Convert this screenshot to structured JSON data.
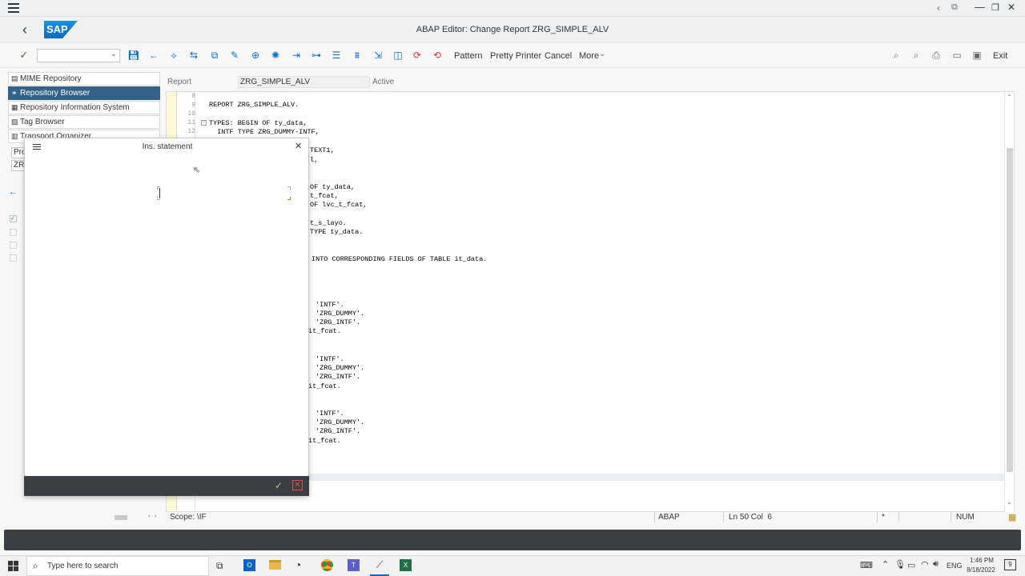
{
  "window": {
    "title": "ABAP Editor: Change Report ZRG_SIMPLE_ALV",
    "logo": "SAP"
  },
  "toolbar": {
    "command_field_value": "",
    "pattern_label": "Pattern",
    "pretty_printer_label": "Pretty Printer",
    "cancel_label": "Cancel",
    "more_label": "More",
    "exit_label": "Exit"
  },
  "nav": {
    "items": [
      {
        "label": "MIME Repository"
      },
      {
        "label": "Repository Browser"
      },
      {
        "label": "Repository Information System"
      },
      {
        "label": "Tag Browser"
      },
      {
        "label": "Transport Organizer"
      }
    ],
    "field1": "Pro",
    "field2": "ZR"
  },
  "editor": {
    "report_label": "Report",
    "report_name": "ZRG_SIMPLE_ALV",
    "status": "Active",
    "line_numbers": [
      "8",
      "9",
      "10",
      "11",
      "12"
    ],
    "lines": [
      "REPORT ZRG_SIMPLE_ALV.",
      "TYPES: BEGIN OF ty_data,",
      "  INTF TYPE ZRG_DUMMY-INTF,",
      "TEXT1,",
      "l,",
      "OF ty_data,",
      "t_fcat,",
      "OF lvc_t_fcat,",
      "t_s_layo.",
      "TYPE ty_data.",
      "INTO CORRESPONDING FIELDS OF TABLE it_data.",
      "'INTF'.",
      "'ZRG_DUMMY'.",
      "'ZRG_INTF'.",
      "it_fcat.",
      "'INTF'.",
      "'ZRG_DUMMY'.",
      "'ZRG_INTF'.",
      "it_fcat.",
      "'INTF'.",
      "'ZRG_DUMMY'.",
      "'ZRG_INTF'.",
      "it_fcat."
    ]
  },
  "status_bar": {
    "scope": "Scope: \\IF",
    "language": "ABAP",
    "position": "Ln 50 Col  6",
    "mode": "*",
    "num": "NUM"
  },
  "dialog": {
    "title": "Ins. statement"
  },
  "taskbar": {
    "search_placeholder": "Type here to search",
    "lang": "ENG",
    "time": "1:46 PM",
    "date": "8/18/2022",
    "notifications": "9"
  },
  "colors": {
    "selected_nav": "#346187",
    "accent": "#0a6ed1",
    "dark_bar": "#3b3f44"
  }
}
